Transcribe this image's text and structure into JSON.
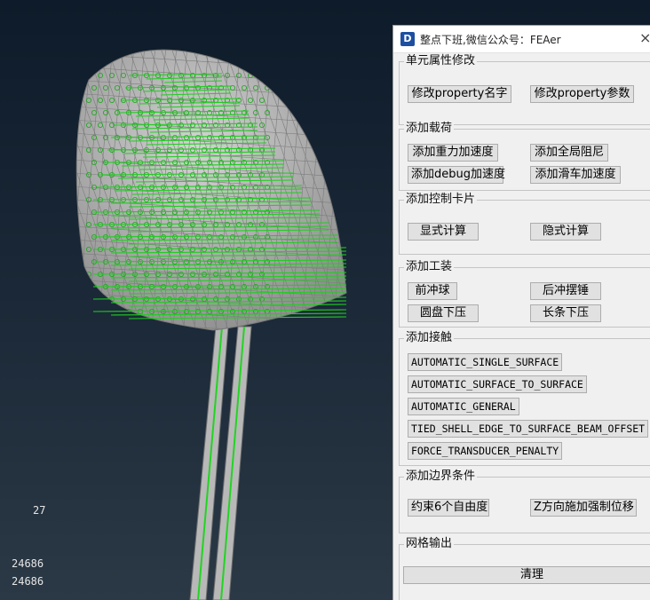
{
  "window": {
    "title": "整点下班,微信公众号：FEAer",
    "icon_glyph": "D",
    "close_glyph": "×"
  },
  "viewport": {
    "labels": [
      "27",
      "24686",
      "24686"
    ]
  },
  "groups": [
    {
      "title": "单元属性修改",
      "buttons": [
        "修改property名字",
        "修改property参数"
      ]
    },
    {
      "title": "添加载荷",
      "buttons": [
        "添加重力加速度",
        "添加全局阻尼",
        "添加debug加速度",
        "添加滑车加速度"
      ]
    },
    {
      "title": "添加控制卡片",
      "buttons": [
        "显式计算",
        "隐式计算"
      ]
    },
    {
      "title": "添加工装",
      "buttons": [
        "前冲球",
        "后冲摆锤",
        "圆盘下压",
        "长条下压"
      ]
    },
    {
      "title": "添加接触",
      "buttons": [
        "AUTOMATIC_SINGLE_SURFACE",
        "AUTOMATIC_SURFACE_TO_SURFACE",
        "AUTOMATIC_GENERAL",
        "TIED_SHELL_EDGE_TO_SURFACE_BEAM_OFFSET",
        "FORCE_TRANSDUCER_PENALTY"
      ]
    },
    {
      "title": "添加边界条件",
      "buttons": [
        "约束6个自由度",
        "Z方向施加强制位移"
      ]
    },
    {
      "title": "网格输出",
      "buttons": [
        "清理"
      ]
    }
  ],
  "colors": {
    "mesh_gray": "#a8a8a8",
    "arrow_green": "#1fcf1f",
    "panel_bg": "#f0f0f0"
  }
}
